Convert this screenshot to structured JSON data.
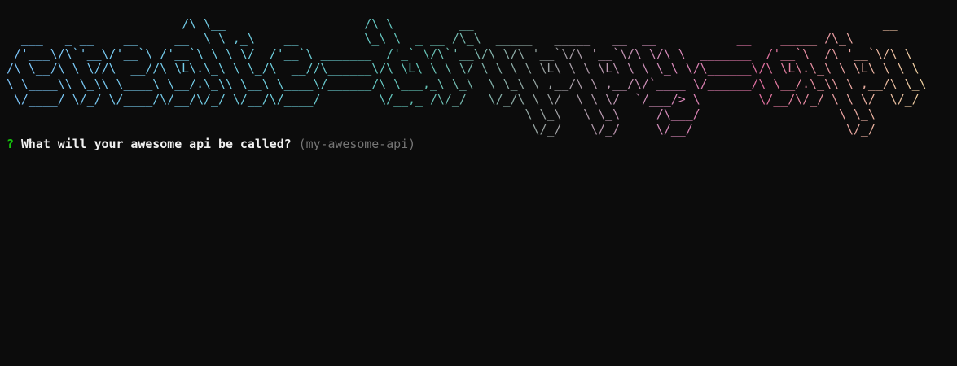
{
  "banner": {
    "lines": [
      "                         __                       __",
      "                        /\\ \\__                   /\\ \\         __                                                        __",
      "  ___   _ __    __     __  \\ \\ ,_\\    __         \\_\\ \\  _ __ /\\_\\  _____   _____   __  __           __    _____ /\\_\\",
      " /'___\\/\\`'__\\/'__`\\ /'__`\\ \\ \\ \\/  /'__`\\ _______  /'_` \\/\\`'__\\/\\ \\/\\ '__`\\/\\ '__`\\/\\ \\/\\ \\  _______  /'__`\\  /\\ '__`\\/\\ \\",
      "/\\ \\__/\\ \\ \\//\\  __//\\ \\L\\.\\_\\ \\ \\_/\\  __//\\______\\/\\ \\L\\ \\ \\ \\/ \\ \\ \\ \\ \\L\\ \\ \\ \\L\\ \\ \\ \\_\\ \\/\\______\\/\\ \\L\\.\\_\\ \\ \\L\\ \\ \\ \\",
      "\\ \\____\\\\ \\_\\\\ \\____\\ \\__/.\\_\\\\ \\__\\ \\____\\/______/\\ \\___,_\\ \\_\\  \\ \\_\\ \\ ,__/\\ \\ ,__/\\/`____ \\/______/\\ \\__/.\\_\\\\ \\ ,__/\\ \\_\\",
      " \\/____/ \\/_/ \\/____/\\/__/\\/_/ \\/__/\\/____/        \\/__,_ /\\/_/   \\/_/\\ \\ \\/  \\ \\ \\/  `/___/> \\        \\/__/\\/_/ \\ \\ \\/  \\/_/",
      "                                                                       \\ \\_\\   \\ \\_\\     /\\___/                   \\ \\_\\",
      "                                                                        \\/_/    \\/_/     \\/__/                     \\/_/"
    ]
  },
  "prompt": {
    "marker": "?",
    "question": "What will your awesome api be called?",
    "default_value": "(my-awesome-api)"
  }
}
